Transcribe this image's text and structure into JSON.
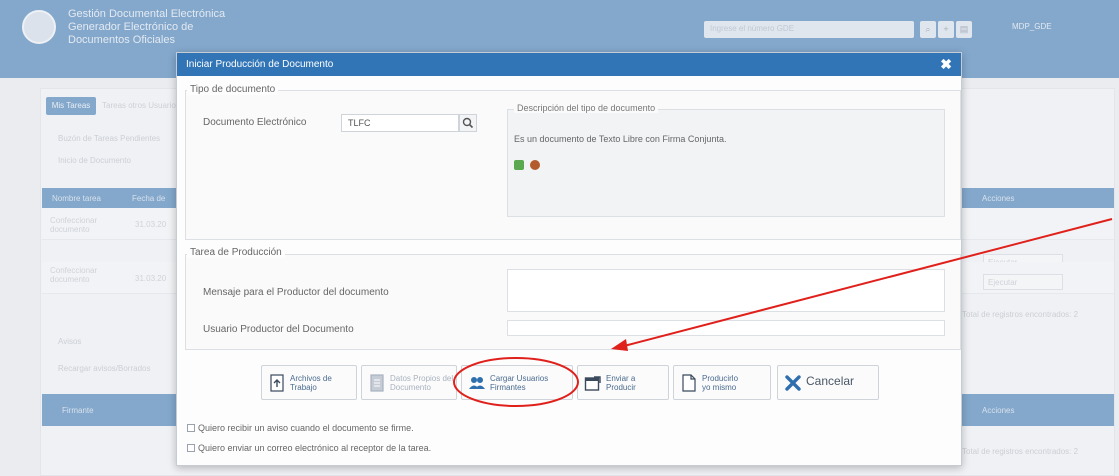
{
  "app": {
    "title_line1": "Gestión Documental Electrónica",
    "title_line2": "Generador Electrónico de",
    "title_line3": "Documentos Oficiales",
    "search_placeholder": "Ingrese el número GDE",
    "user": "MDP_GDE"
  },
  "background": {
    "tab_active": "Mis Tareas",
    "tab_other": "Tareas otros Usuarios",
    "buzon": "Buzón de Tareas Pendientes",
    "inicio": "Inicio de Documento",
    "col_nombre": "Nombre tarea",
    "col_fecha": "Fecha de",
    "col_acciones": "Acciones",
    "row1_name": "Confeccionar documento",
    "row1_date": "31.03.20",
    "row2_name": "Confeccionar documento",
    "row2_date": "31.03.20",
    "ejecutar": "Ejecutar",
    "registros": "Total de registros encontrados: 2",
    "avisos": "Avisos",
    "recargar": "Recargar avisos/Borrados",
    "col_firmante": "Firmante",
    "col_acciones2": "Acciones"
  },
  "modal": {
    "title": "Iniciar Producción de Documento",
    "close_glyph": "✖",
    "tipo_section": "Tipo de documento",
    "doc_label": "Documento Electrónico",
    "doc_value": "TLFC",
    "desc_title": "Descripción del tipo de documento",
    "desc_text": "Es un documento de Texto Libre con Firma Conjunta.",
    "tarea_section": "Tarea de Producción",
    "mensaje_label": "Mensaje para el Productor del documento",
    "usuario_label": "Usuario Productor del Documento",
    "buttons": {
      "archivos": [
        "Archivos de",
        "Trabajo"
      ],
      "datos": [
        "Datos Propios del",
        "Documento"
      ],
      "cargar": [
        "Cargar Usuarios",
        "Firmantes"
      ],
      "enviar": [
        "Enviar a",
        "Producir"
      ],
      "producirlo": [
        "Producirlo",
        "yo mismo"
      ],
      "cancelar": "Cancelar"
    },
    "check1": "Quiero recibir un aviso cuando el documento se firme.",
    "check2": "Quiero enviar un correo electrónico al receptor de la tarea."
  },
  "colors": {
    "header_blue": "#3275b7",
    "annotation_red": "#e0201b"
  }
}
